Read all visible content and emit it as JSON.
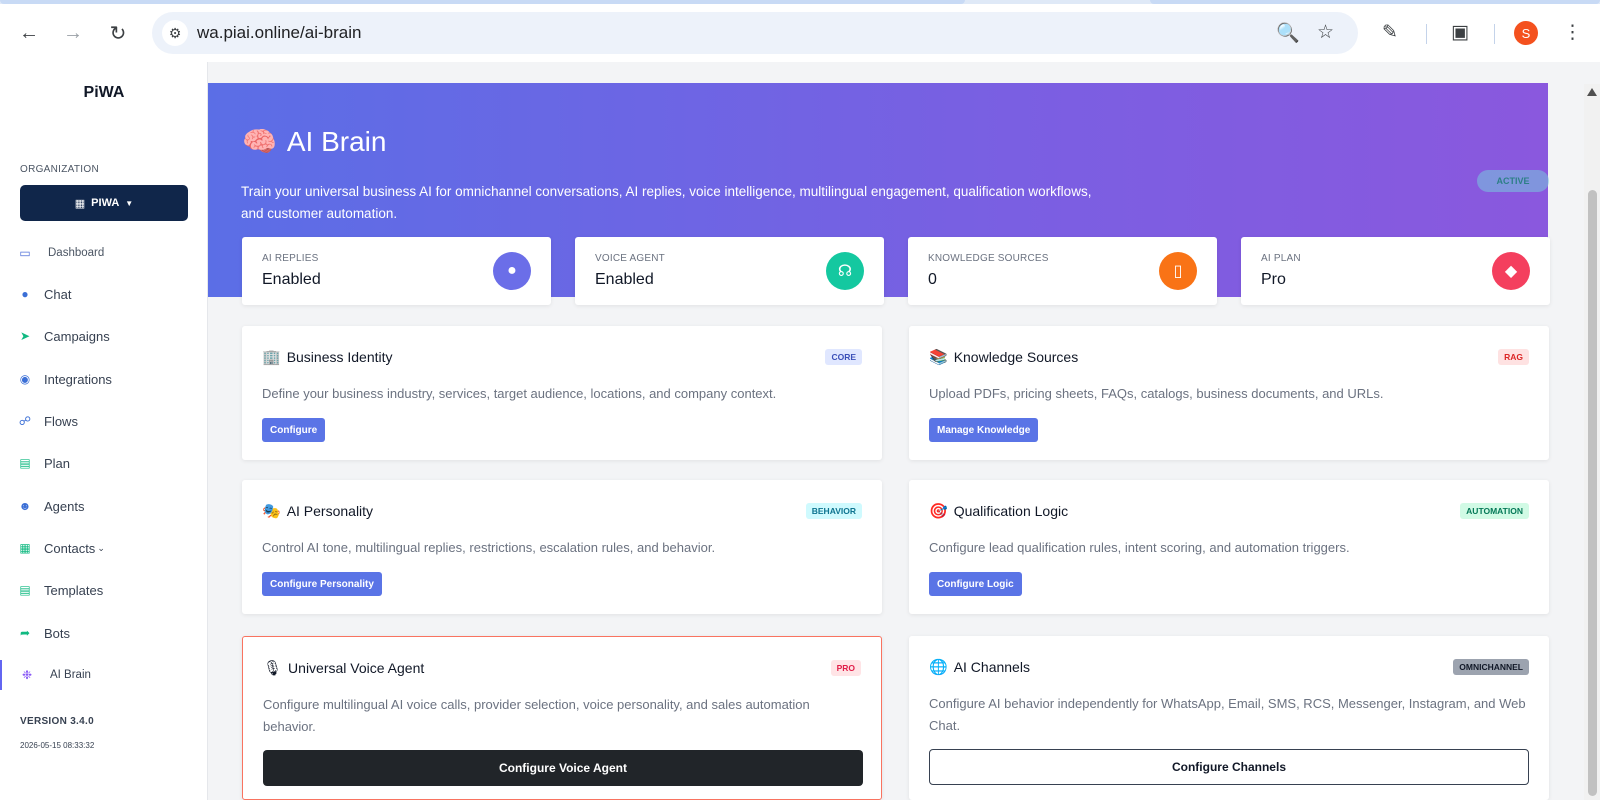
{
  "browser": {
    "url": "wa.piai.online/ai-brain",
    "profile_initial": "S"
  },
  "sidebar": {
    "brand": "PiWA",
    "org_label": "ORGANIZATION",
    "org_button": "PIWA",
    "items": [
      {
        "label": "Dashboard",
        "icon": "monitor-icon",
        "color": "#4f6fd8"
      },
      {
        "label": "Chat",
        "icon": "chat-icon",
        "color": "#3b6fd6"
      },
      {
        "label": "Campaigns",
        "icon": "send-icon",
        "color": "#10b981"
      },
      {
        "label": "Integrations",
        "icon": "globe-icon",
        "color": "#3b6fd6"
      },
      {
        "label": "Flows",
        "icon": "flow-icon",
        "color": "#3b6fd6"
      },
      {
        "label": "Plan",
        "icon": "plan-icon",
        "color": "#10b981"
      },
      {
        "label": "Agents",
        "icon": "user-icon",
        "color": "#3b6fd6"
      },
      {
        "label": "Contacts",
        "icon": "contacts-icon",
        "color": "#10b981"
      },
      {
        "label": "Templates",
        "icon": "template-icon",
        "color": "#10b981"
      },
      {
        "label": "Bots",
        "icon": "share-icon",
        "color": "#10b981"
      },
      {
        "label": "AI Brain",
        "icon": "brain-gear-icon",
        "color": "#8b5cf6"
      }
    ],
    "version": "VERSION 3.4.0",
    "timestamp": "2026-05-15 08:33:32"
  },
  "hero": {
    "title": "AI Brain",
    "description": "Train your universal business AI for omnichannel conversations, AI replies, voice intelligence, multilingual engagement, qualification workflows, and customer automation.",
    "status_badge": "ACTIVE"
  },
  "stats": [
    {
      "label": "AI REPLIES",
      "value": "Enabled",
      "icon": "chat-bubble-icon",
      "color": "#6b6ee8"
    },
    {
      "label": "VOICE AGENT",
      "value": "Enabled",
      "icon": "headphones-icon",
      "color": "#14c8a0"
    },
    {
      "label": "KNOWLEDGE SOURCES",
      "value": "0",
      "icon": "books-icon",
      "color": "#f97316"
    },
    {
      "label": "AI PLAN",
      "value": "Pro",
      "icon": "gem-icon",
      "color": "#f43f5e"
    }
  ],
  "cards": [
    {
      "title": "Business Identity",
      "badge": "CORE",
      "badge_bg": "#e0e7ff",
      "badge_fg": "#3b4fb8",
      "desc": "Define your business industry, services, target audience, locations, and company context.",
      "button": "Configure",
      "emoji": "🏢"
    },
    {
      "title": "Knowledge Sources",
      "badge": "RAG",
      "badge_bg": "#fee2e2",
      "badge_fg": "#dc2626",
      "desc": "Upload PDFs, pricing sheets, FAQs, catalogs, business documents, and URLs.",
      "button": "Manage Knowledge",
      "emoji": "📚"
    },
    {
      "title": "AI Personality",
      "badge": "BEHAVIOR",
      "badge_bg": "#cffafe",
      "badge_fg": "#0e7490",
      "desc": "Control AI tone, multilingual replies, restrictions, escalation rules, and behavior.",
      "button": "Configure Personality",
      "emoji": "🎭"
    },
    {
      "title": "Qualification Logic",
      "badge": "AUTOMATION",
      "badge_bg": "#d1fae5",
      "badge_fg": "#047857",
      "desc": "Configure lead qualification rules, intent scoring, and automation triggers.",
      "button": "Configure Logic",
      "emoji": "🎯"
    },
    {
      "title": "Universal Voice Agent",
      "badge": "PRO",
      "badge_bg": "#ffe4e6",
      "badge_fg": "#e11d48",
      "desc": "Configure multilingual AI voice calls, provider selection, voice personality, and sales automation behavior.",
      "button": "Configure Voice Agent",
      "emoji": "🎙"
    },
    {
      "title": "AI Channels",
      "badge": "OMNICHANNEL",
      "badge_bg": "#9ca3af",
      "badge_fg": "#111827",
      "desc": "Configure AI behavior independently for WhatsApp, Email, SMS, RCS, Messenger, Instagram, and Web Chat.",
      "button": "Configure Channels",
      "emoji": "🌐"
    }
  ]
}
